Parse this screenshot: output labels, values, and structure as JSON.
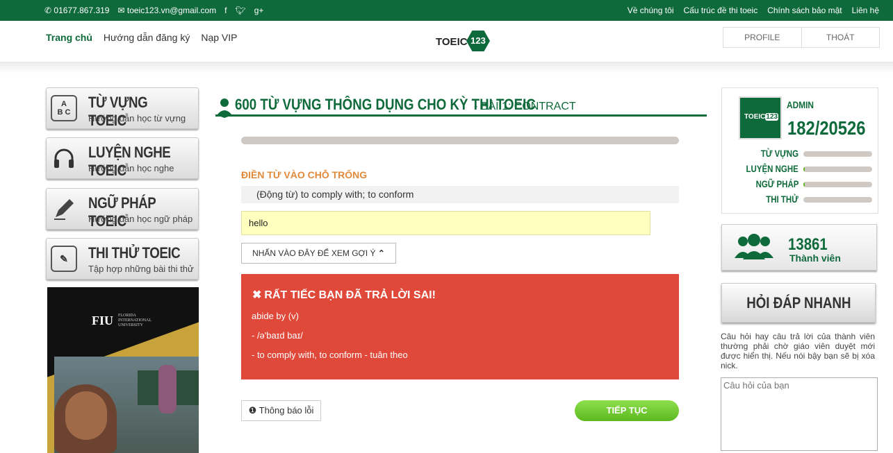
{
  "topbar": {
    "phone": "01677.867.319",
    "email": "toeic123.vn@gmail.com",
    "links": [
      "Về chúng tôi",
      "Cấu trúc đề thi toeic",
      "Chính sách bảo mật",
      "Liên hệ"
    ]
  },
  "nav": {
    "links": [
      "Trang chủ",
      "Hướng dẫn đăng ký",
      "Nạp VIP"
    ],
    "logo_text": "TOEIC",
    "logo_num": "123",
    "profile": "PROFILE",
    "logout": "THOÁT"
  },
  "menu": [
    {
      "title": "TỪ VỰNG TOEIC",
      "sub": "Hướng dẫn học từ vựng"
    },
    {
      "title": "LUYỆN NGHE TOEIC",
      "sub": "Hướng dẫn học nghe"
    },
    {
      "title": "NGỮ PHÁP TOEIC",
      "sub": "Hướng dẫn học ngữ pháp"
    },
    {
      "title": "THI THỬ TOEIC",
      "sub": "Tập hợp những bài thi thử"
    }
  ],
  "ad": {
    "logo": "FIU",
    "sub1": "FLORIDA",
    "sub2": "INTERNATIONAL",
    "sub3": "UNIVERSITY"
  },
  "lesson": {
    "title": "600 TỪ VỰNG THÔNG DỤNG CHO KỲ THI TOEIC",
    "subtitle": "- BÀI 1: CONTRACT",
    "instruction": "ĐIỀN TỪ VÀO CHỖ TRỐNG",
    "hint": "(Động từ) to comply with; to conform",
    "answer": "hello",
    "hint_button": "NHẤN VÀO ĐÂY ĐỂ XEM GỢI Ý"
  },
  "result": {
    "heading": "RẤT TIẾC BẠN ĐÃ TRẢ LỜI SAI!",
    "line1": "abide by (v)",
    "line2": "- /ə'baɪd baɪ/",
    "line3": "- to comply with, to conform - tuân theo"
  },
  "actions": {
    "report": "Thông báo lỗi",
    "next": "TIẾP TỤC"
  },
  "user": {
    "name": "ADMIN",
    "score": "182/20526",
    "skills": [
      {
        "label": "TỪ VỰNG",
        "progress": 0
      },
      {
        "label": "LUYỆN NGHE",
        "progress": 0.02
      },
      {
        "label": "NGỮ PHÁP",
        "progress": 0.02
      },
      {
        "label": "THI THỬ",
        "progress": 0
      }
    ]
  },
  "members": {
    "count": "13861",
    "label": "Thành viên"
  },
  "qa": {
    "title": "HỎI ĐÁP NHANH",
    "note": "Câu hỏi hay câu trả lời của thành viên thường phải chờ giáo viên duyệt mới được hiển thị. Nếu nói bậy bạn sẽ bị xóa nick.",
    "placeholder": "Câu hỏi của bạn"
  }
}
